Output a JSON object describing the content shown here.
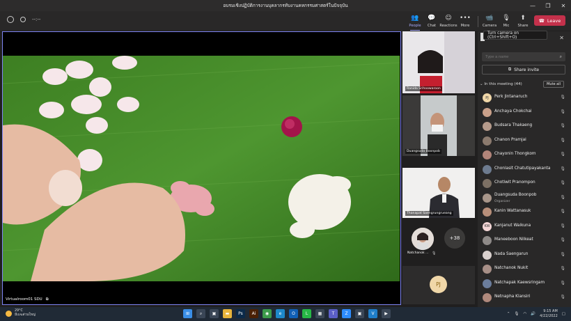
{
  "window": {
    "title": "อบรมเชิงปฏิบัติการงานบุคลากรทับงานคหกรรมศาสตร์ในปัจจุบัน",
    "controls": [
      "—",
      "❐",
      "✕"
    ]
  },
  "toolbar": {
    "timer": "--:--",
    "buttons": [
      {
        "label": "People",
        "icon": "people-icon",
        "glyph": "👥"
      },
      {
        "label": "Chat",
        "icon": "chat-icon",
        "glyph": "💬"
      },
      {
        "label": "Reactions",
        "icon": "reactions-icon",
        "glyph": "☺"
      },
      {
        "label": "More",
        "icon": "more-icon",
        "glyph": "•••"
      },
      {
        "label": "Camera",
        "icon": "camera-off-icon",
        "glyph": "📹"
      },
      {
        "label": "Mic",
        "icon": "mic-off-icon",
        "glyph": "🎙"
      },
      {
        "label": "Share",
        "icon": "share-icon",
        "glyph": "⬆"
      }
    ],
    "leave_label": "Leave"
  },
  "tooltip": "Turn camera on (Ctrl+Shift+O)",
  "main_video": {
    "label": "Virtualroom01 SDU"
  },
  "gallery": {
    "tiles": [
      {
        "name": "Ranida Srihoowaroon"
      },
      {
        "name": "Duangsuda Boonpob"
      },
      {
        "name": "Thanapat Saengrungrueang"
      },
      {
        "name": "Natchanok ..."
      }
    ],
    "more_count": "+38",
    "pj_initials": "PJ"
  },
  "panel": {
    "search_placeholder": "Type a name",
    "invite_label": "Share invite",
    "section_label": "In this meeting (44)",
    "mute_all_label": "Mute all",
    "people": [
      {
        "name": "Perk Jintanaruch",
        "initials": "PJ",
        "color": "#f0d7a8",
        "role": ""
      },
      {
        "name": "Anchaya Chokchai",
        "initials": "",
        "color": "#c9a08a",
        "role": ""
      },
      {
        "name": "Budsara Thakaeng",
        "initials": "",
        "color": "#b59a8b",
        "role": ""
      },
      {
        "name": "Chanon Pramjai",
        "initials": "",
        "color": "#8b7a6e",
        "role": ""
      },
      {
        "name": "Chayonin Thongkom",
        "initials": "",
        "color": "#b2857a",
        "role": ""
      },
      {
        "name": "Chonlasit Chatutipayakanta",
        "initials": "",
        "color": "#6d7b8f",
        "role": ""
      },
      {
        "name": "Chotiwit Pranompon",
        "initials": "",
        "color": "#7c7064",
        "role": ""
      },
      {
        "name": "Duangsuda Boonpob",
        "initials": "",
        "color": "#a8968a",
        "role": "Organizer"
      },
      {
        "name": "Kanin Wattanasuk",
        "initials": "",
        "color": "#b88f7a",
        "role": ""
      },
      {
        "name": "Kanjanut Waikuna",
        "initials": "KW",
        "color": "#f3d6d6",
        "role": ""
      },
      {
        "name": "Maneeboon Nilkeat",
        "initials": "",
        "color": "#8e8a88",
        "role": ""
      },
      {
        "name": "Nada Saengarun",
        "initials": "",
        "color": "#d9d0ce",
        "role": ""
      },
      {
        "name": "Natchanok Nukit",
        "initials": "",
        "color": "#a78f87",
        "role": ""
      },
      {
        "name": "Natchapak Kaewsringam",
        "initials": "",
        "color": "#6b7d9c",
        "role": ""
      },
      {
        "name": "Netnapha Klansiri",
        "initials": "",
        "color": "#b0897c",
        "role": ""
      }
    ]
  },
  "taskbar": {
    "temperature": "29°C",
    "weather_desc": "มีเมฆส่วนใหญ่",
    "apps": [
      {
        "icon": "windows-start-icon",
        "glyph": "⊞",
        "color": "#3a8ee6"
      },
      {
        "icon": "search-icon",
        "glyph": "⌕",
        "color": "#3a4656"
      },
      {
        "icon": "task-view-icon",
        "glyph": "▣",
        "color": "#3a4656"
      },
      {
        "icon": "file-explorer-icon",
        "glyph": "▬",
        "color": "#e8b43c"
      },
      {
        "icon": "photoshop-icon",
        "glyph": "Ps",
        "color": "#0b2a4a"
      },
      {
        "icon": "illustrator-icon",
        "glyph": "Ai",
        "color": "#4a2005"
      },
      {
        "icon": "chrome-icon",
        "glyph": "◉",
        "color": "#3c9b4b"
      },
      {
        "icon": "edge-icon",
        "glyph": "e",
        "color": "#1e88c9"
      },
      {
        "icon": "outlook-icon",
        "glyph": "O",
        "color": "#1160b5"
      },
      {
        "icon": "line-icon",
        "glyph": "L",
        "color": "#27b846"
      },
      {
        "icon": "store-icon",
        "glyph": "▦",
        "color": "#3a4656"
      },
      {
        "icon": "teams-icon",
        "glyph": "T",
        "color": "#5b5fc7"
      },
      {
        "icon": "zoom-icon",
        "glyph": "Z",
        "color": "#2d8cff"
      },
      {
        "icon": "app-icon",
        "glyph": "▣",
        "color": "#3a4656"
      },
      {
        "icon": "vscode-icon",
        "glyph": "V",
        "color": "#1f7ec9"
      },
      {
        "icon": "media-icon",
        "glyph": "▶",
        "color": "#3a4656"
      }
    ],
    "time": "9:15 AM",
    "date": "4/22/2022"
  }
}
